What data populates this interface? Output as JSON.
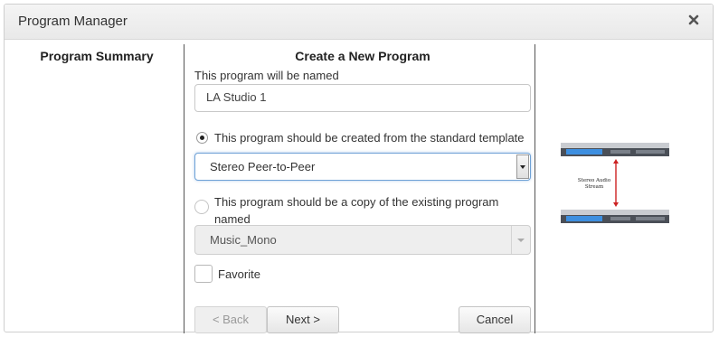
{
  "window": {
    "title": "Program Manager",
    "close_icon": "close-icon"
  },
  "summary": {
    "heading": "Program Summary"
  },
  "create": {
    "heading": "Create a New Program",
    "name_label": "This program will be named",
    "name_value": "LA Studio 1",
    "template_option": {
      "label": "This program should be created from the standard template",
      "selected": true
    },
    "template_select": {
      "value": "Stereo Peer-to-Peer"
    },
    "copy_option": {
      "label": "This program should be a copy of the existing program named",
      "selected": false
    },
    "copy_select": {
      "value": "Music_Mono",
      "disabled": true
    },
    "favorite": {
      "label": "Favorite",
      "checked": false
    },
    "buttons": {
      "back": "< Back",
      "next": "Next >",
      "cancel": "Cancel"
    }
  },
  "illustration": {
    "caption_line1": "Stereo Audio",
    "caption_line2": "Stream",
    "arrow_color": "#cc2222",
    "device_color": "#4a4f57",
    "accent_color": "#3d8fe0"
  }
}
